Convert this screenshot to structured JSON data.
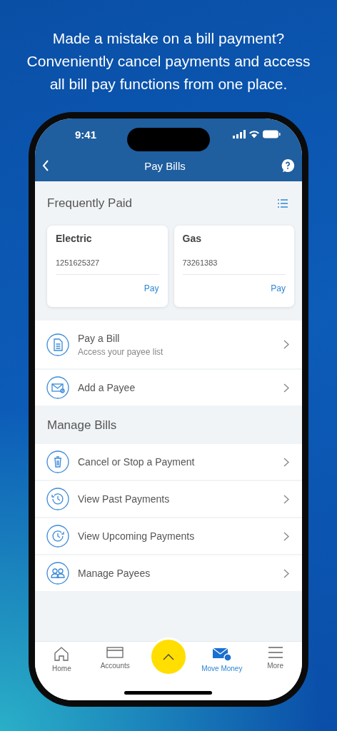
{
  "headline": [
    "Made a mistake on a bill payment?",
    "Conveniently cancel payments and access",
    "all bill pay functions from one place."
  ],
  "status_bar": {
    "time": "9:41"
  },
  "nav": {
    "title": "Pay Bills"
  },
  "frequently_paid": {
    "title": "Frequently Paid",
    "payees": [
      {
        "name": "Electric",
        "account": "1251625327",
        "action": "Pay"
      },
      {
        "name": "Gas",
        "account": "73261383",
        "action": "Pay"
      }
    ]
  },
  "actions": [
    {
      "title": "Pay a Bill",
      "subtitle": "Access your payee list"
    },
    {
      "title": "Add a Payee"
    }
  ],
  "manage_bills": {
    "title": "Manage Bills",
    "items": [
      {
        "title": "Cancel or Stop a Payment"
      },
      {
        "title": "View Past Payments"
      },
      {
        "title": "View Upcoming Payments"
      },
      {
        "title": "Manage Payees"
      }
    ]
  },
  "tab_bar": [
    {
      "label": "Home",
      "selected": false
    },
    {
      "label": "Accounts",
      "selected": false
    },
    {
      "label": "Move Money",
      "selected": true
    },
    {
      "label": "More",
      "selected": false
    }
  ]
}
